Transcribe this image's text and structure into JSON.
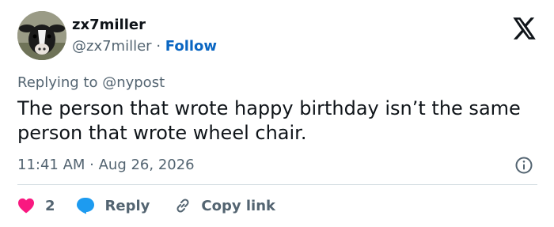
{
  "author": {
    "display_name": "zx7miller",
    "handle": "@zx7miller",
    "separator": "·",
    "follow_label": "Follow",
    "avatar_icon": "cow-avatar"
  },
  "brand_icon": "x-logo-icon",
  "tweet": {
    "replying_to": "Replying to @nypost",
    "text": "The person that wrote happy birthday isn’t the same person that wrote wheel chair.",
    "timestamp": "11:41 AM · Aug 26, 2026"
  },
  "actions": {
    "like_count": "2",
    "reply_label": "Reply",
    "copy_label": "Copy link"
  },
  "colors": {
    "like": "#f91880",
    "reply": "#1d9bf0",
    "follow": "#0a66c2",
    "secondary_text": "#536471"
  }
}
